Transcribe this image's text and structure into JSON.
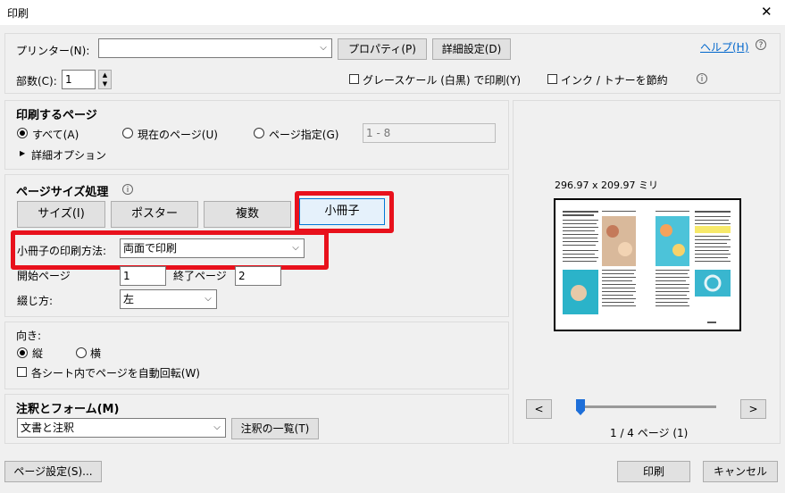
{
  "window": {
    "title": "印刷",
    "close_glyph": "✕"
  },
  "printer": {
    "label": "プリンター(N):",
    "value": "",
    "properties_button": "プロパティ(P)",
    "advanced_button": "詳細設定(D)"
  },
  "help": {
    "link": "ヘルプ(H)"
  },
  "copies": {
    "label": "部数(C):",
    "value": "1"
  },
  "grayscale": {
    "label": "グレースケール (白黒) で印刷(Y)",
    "checked": false
  },
  "save_ink": {
    "label": "インク / トナーを節約",
    "checked": false
  },
  "pages_to_print": {
    "heading": "印刷するページ",
    "all": "すべて(A)",
    "current": "現在のページ(U)",
    "pages": "ページ指定(G)",
    "range_value": "1 - 8",
    "more_options": "詳細オプション"
  },
  "page_sizing": {
    "heading": "ページサイズ処理",
    "tabs": [
      "サイズ(I)",
      "ポスター",
      "複数",
      "小冊子"
    ],
    "selected_tab": "小冊子",
    "booklet_method_label": "小冊子の印刷方法:",
    "booklet_method_value": "両面で印刷",
    "start_page_label": "開始ページ",
    "start_page_value": "1",
    "end_page_label": "終了ページ",
    "end_page_value": "2",
    "binding_label": "綴じ方:",
    "binding_value": "左"
  },
  "orientation": {
    "heading": "向き:",
    "portrait": "縦",
    "landscape": "横",
    "auto_rotate": "各シート内でページを自動回転(W)"
  },
  "comments": {
    "heading": "注釈とフォーム(M)",
    "value": "文書と注釈",
    "summary_button": "注釈の一覧(T)"
  },
  "preview": {
    "size_text": "296.97 x 209.97 ミリ",
    "page_indicator": "1 / 4 ページ (1)",
    "prev": "<",
    "next": ">",
    "slider_fraction": 0.0
  },
  "footer": {
    "page_setup": "ページ設定(S)...",
    "print": "印刷",
    "cancel": "キャンセル"
  },
  "colors": {
    "accent_red": "#e8111c",
    "link_blue": "#0066cc",
    "slider_blue": "#1e6fd9"
  }
}
